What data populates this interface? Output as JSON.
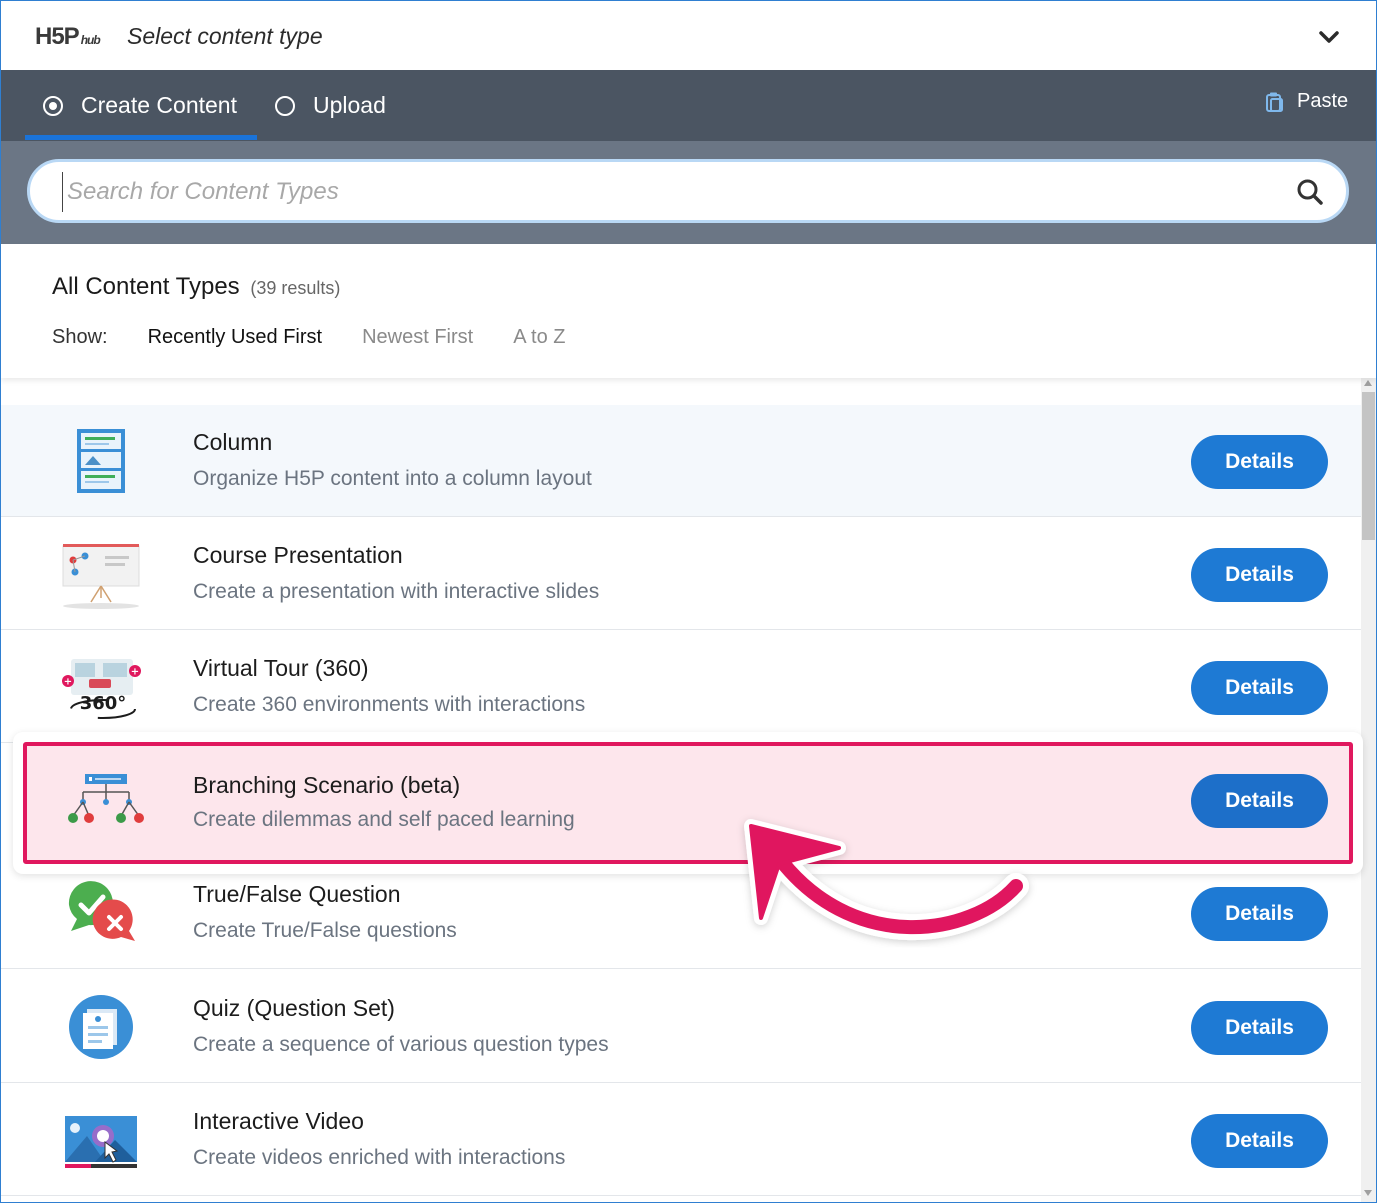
{
  "header": {
    "logo_main": "H5P",
    "logo_sub": "hub",
    "title": "Select content type"
  },
  "tabs": [
    {
      "label": "Create Content",
      "selected": true
    },
    {
      "label": "Upload",
      "selected": false
    }
  ],
  "paste_label": "Paste",
  "search": {
    "placeholder": "Search for Content Types"
  },
  "results": {
    "heading": "All Content Types",
    "count": "(39 results)",
    "show_label": "Show:",
    "sort_options": [
      "Recently Used First",
      "Newest First",
      "A to Z"
    ],
    "active_sort": "Recently Used First"
  },
  "items": [
    {
      "title": "Column",
      "desc": "Organize H5P content into a column layout",
      "button": "Details",
      "icon": "column-icon"
    },
    {
      "title": "Course Presentation",
      "desc": "Create a presentation with interactive slides",
      "button": "Details",
      "icon": "presentation-board-icon"
    },
    {
      "title": "Virtual Tour (360)",
      "desc": "Create 360 environments with interactions",
      "button": "Details",
      "icon": "virtual-tour-360-icon"
    },
    {
      "title": "Branching Scenario (beta)",
      "desc": "Create dilemmas and self paced learning",
      "button": "Details",
      "icon": "branching-tree-icon"
    },
    {
      "title": "True/False Question",
      "desc": "Create True/False questions",
      "button": "Details",
      "icon": "true-false-bubbles-icon"
    },
    {
      "title": "Quiz (Question Set)",
      "desc": "Create a sequence of various question types",
      "button": "Details",
      "icon": "quiz-sheet-icon"
    },
    {
      "title": "Interactive Video",
      "desc": "Create videos enriched with interactions",
      "button": "Details",
      "icon": "interactive-video-icon"
    }
  ],
  "colors": {
    "accent_blue": "#1e7ad4",
    "tab_bar": "#4b5562",
    "search_band": "#6b7685",
    "highlight_border": "#e0185e",
    "highlight_fill": "#fde6ec"
  }
}
